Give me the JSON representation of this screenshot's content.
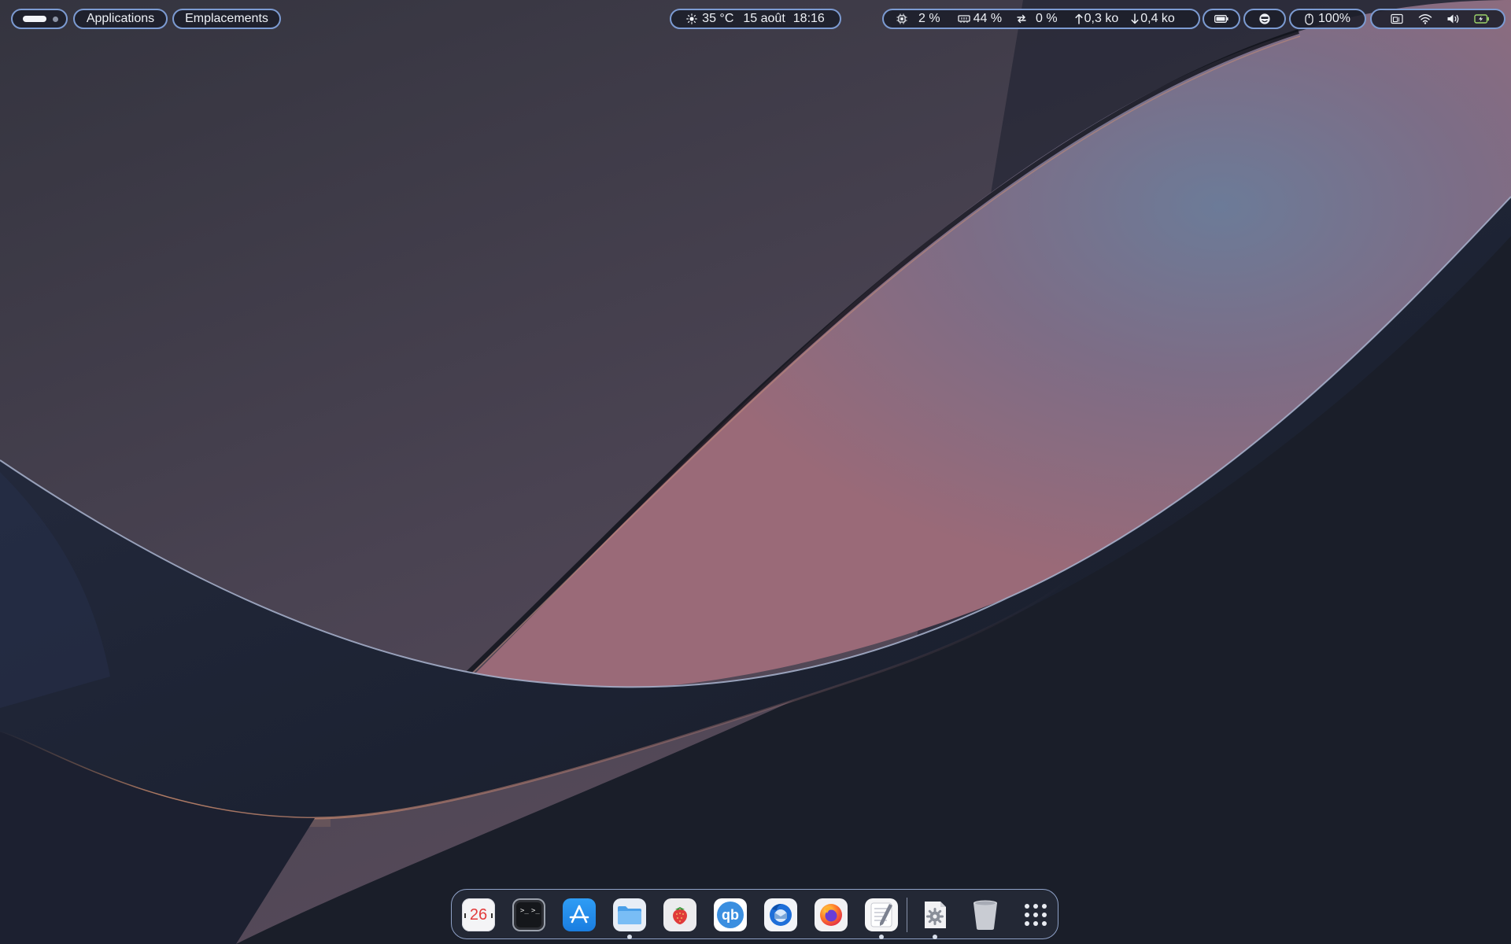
{
  "topbar": {
    "menu_applications": "Applications",
    "menu_places": "Emplacements",
    "weather_temp": "35 °C",
    "date": "15 août",
    "time": "18:16",
    "cpu": "2 %",
    "memory": "44 %",
    "swap": "0 %",
    "net_up": "0,3 ko",
    "net_down": "0,4 ko",
    "mouse_battery": "100%",
    "tray_icons": [
      "display-settings-icon",
      "wifi-icon",
      "volume-icon",
      "battery-charging-icon"
    ]
  },
  "dock": {
    "calendar_day": "26",
    "items": [
      {
        "name": "calendar",
        "running": false
      },
      {
        "name": "terminal",
        "running": false
      },
      {
        "name": "app-store",
        "running": false
      },
      {
        "name": "files",
        "running": true
      },
      {
        "name": "strawberry",
        "running": false
      },
      {
        "name": "qbittorrent",
        "running": false
      },
      {
        "name": "thunderbird",
        "running": false
      },
      {
        "name": "firefox",
        "running": false
      },
      {
        "name": "text-editor",
        "running": true
      },
      {
        "name": "settings",
        "running": true
      },
      {
        "name": "trash",
        "running": false
      },
      {
        "name": "show-apps",
        "running": false
      }
    ]
  },
  "colors": {
    "accent": "#7c9bd2",
    "panel_bg": "#1c1f2a",
    "wallpaper_dark": "#1b1e28",
    "wallpaper_ribbon": "#6b7895"
  }
}
